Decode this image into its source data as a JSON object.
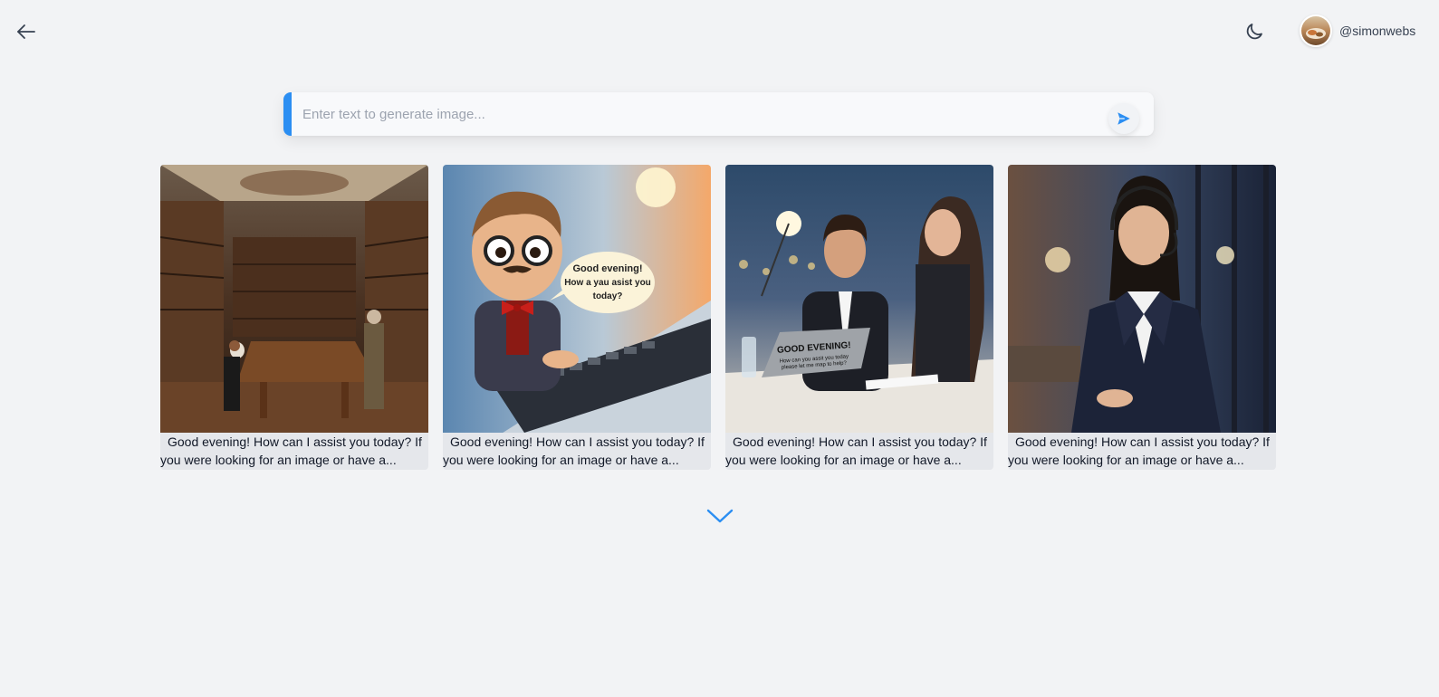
{
  "header": {
    "back_icon": "arrow-left-icon",
    "theme_icon": "moon-icon",
    "user": {
      "username": "@simonwebs",
      "avatar_icon": "avatar"
    }
  },
  "prompt": {
    "placeholder": "Enter text to generate image...",
    "value": "",
    "send_icon": "send-icon",
    "accent_color": "#2b8ef2"
  },
  "gallery": {
    "items": [
      {
        "scene": "library",
        "caption": "Good evening! How can I assist you today? If you were looking for an image or have a..."
      },
      {
        "scene": "cartoon",
        "caption": "Good evening! How can I assist you today? If you were looking for an image or have a...",
        "bubble": [
          "Good evening!",
          "How a yau asist you",
          "today?"
        ]
      },
      {
        "scene": "office",
        "caption": "Good evening! How can I assist you today? If you were looking for an image or have a...",
        "laptop_text": [
          "GOOD EVENING!",
          "How can you assit you today",
          "please let me map to help?"
        ]
      },
      {
        "scene": "agent",
        "caption": "Good evening! How can I assist you today? If you were looking for an image or have a..."
      }
    ]
  },
  "load_more_icon": "chevron-down-icon"
}
